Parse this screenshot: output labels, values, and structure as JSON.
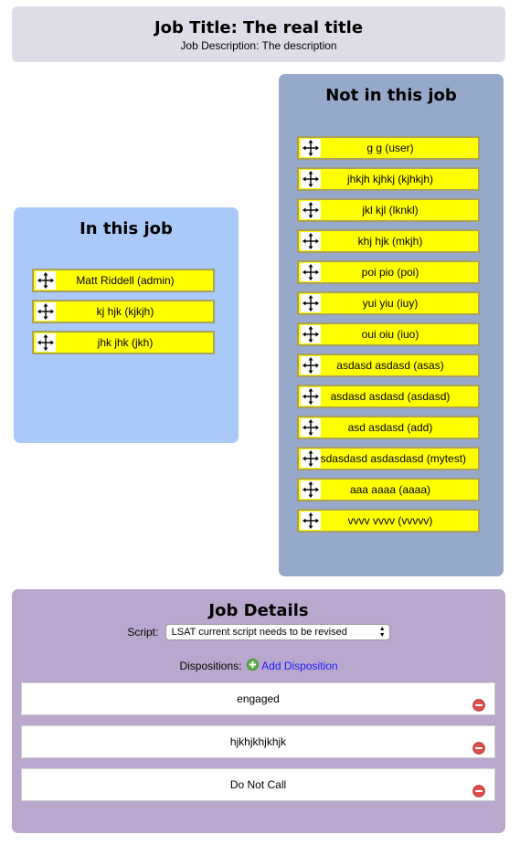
{
  "header": {
    "title": "Job Title: The real title",
    "description": "Job Description: The description"
  },
  "in_job": {
    "heading": "In this job",
    "members": [
      "Matt Riddell (admin)",
      "kj hjk (kjkjh)",
      "jhk jhk (jkh)"
    ]
  },
  "not_in_job": {
    "heading": "Not in this job",
    "members": [
      "g g (user)",
      "jhkjh kjhkj (kjhkjh)",
      "jkl kjl (lknkl)",
      "khj hjk (mkjh)",
      "poi pio (poi)",
      "yui yiu (iuy)",
      "oui oiu (iuo)",
      "asdasd asdasd (asas)",
      "asdasd asdasd (asdasd)",
      "asd asdasd (add)",
      "asdasdasd asdasdasd (mytest)",
      "aaa aaaa (aaaa)",
      "vvvv vvvv (vvvvv)"
    ]
  },
  "job_details": {
    "heading": "Job Details",
    "script_label": "Script:",
    "script_selected": "LSAT current script needs to be revised",
    "dispositions_label": "Dispositions:",
    "add_disposition_label": "Add Disposition",
    "dispositions": [
      "engaged",
      "hjkhjkhjkhjk",
      "Do Not Call"
    ]
  },
  "icons": {
    "drag_handle": "move-arrows-icon",
    "add": "green-plus-circle-icon",
    "remove": "red-minus-circle-icon"
  },
  "colors": {
    "header_bg": "#dddde8",
    "in_job_bg": "#a9c9f9",
    "not_in_job_bg": "#97a9cb",
    "job_details_bg": "#baa7cd",
    "item_bg": "#ffff00",
    "link": "#1a1aff"
  }
}
